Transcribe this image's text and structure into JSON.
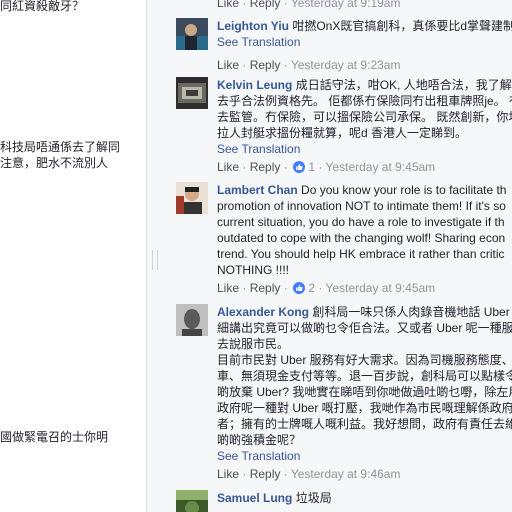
{
  "left_pane": {
    "lines": [
      "同紅資殺敵牙？",
      "科技局唔通係去了解同",
      "注意，肥水不流別人",
      "國做緊電召的士你明"
    ]
  },
  "top_actions": {
    "like": "Like",
    "reply": "Reply",
    "time": "Yesterday at 9:19am"
  },
  "comments": [
    {
      "author": "Leighton Yiu",
      "lines": [
        "咁撚OnX既官搞創科，真係要比d掌聲建制"
      ],
      "see_translation": "See Translation",
      "like": "Like",
      "reply": "Reply",
      "time": "Yesterday at 9:23am"
    },
    {
      "author": "Kelvin Leung",
      "lines": [
        "成日話守法，咁OK, 人地唔合法，我了解",
        "去乎合法例資格先。 佢都係冇保險同冇出租車牌照je。 冇",
        "去監管。冇保險，可以搵保險公司承保。 既然創新，你址",
        "拉人封艇求搵份糧就算，呢d 香港人一定睇到。"
      ],
      "see_translation": "See Translation",
      "like": "Like",
      "reply": "Reply",
      "reactions": "1",
      "time": "Yesterday at 9:45am"
    },
    {
      "author": "Lambert Chan",
      "lines": [
        "Do you know your role is to facilitate th",
        "promotion of innovation NOT to intimate them! If it's so",
        "current situation, you do have a role to investigate if th",
        "outdated to cope with the changing wolf! Sharing econ",
        "trend. You should help HK embrace it rather than critic",
        "NOTHING !!!!"
      ],
      "like": "Like",
      "reply": "Reply",
      "reactions": "2",
      "time": "Yesterday at 9:45am"
    },
    {
      "author": "Alexander Kong",
      "lines": [
        "創科局一味只係人肉錄音機地話 Uber",
        "細講出究竟可以做啲乜令佢合法。又或者 Uber 呢一種服",
        "去說服市民。",
        "目前市民對 Uber 服務有好大需求。因為司機服務態度、",
        "車、無須現金支付等等。退一百步說，創科局可以點樣令",
        "啲放棄 Uber? 我哋實在睇唔到你哋做過吐啲乜嘢，除左用",
        "政府呢一種對 Uber 嘅打壓，我哋作為市民嘅理解係政府",
        "者；擁有的士牌嘅人嘅利益。我好想問，政府有責任去維",
        "啲啲強積金呢？"
      ],
      "see_translation": "See Translation",
      "like": "Like",
      "reply": "Reply",
      "time": "Yesterday at 9:46am"
    },
    {
      "author": "Samuel Lung",
      "lines": [
        "垃圾局"
      ]
    }
  ]
}
